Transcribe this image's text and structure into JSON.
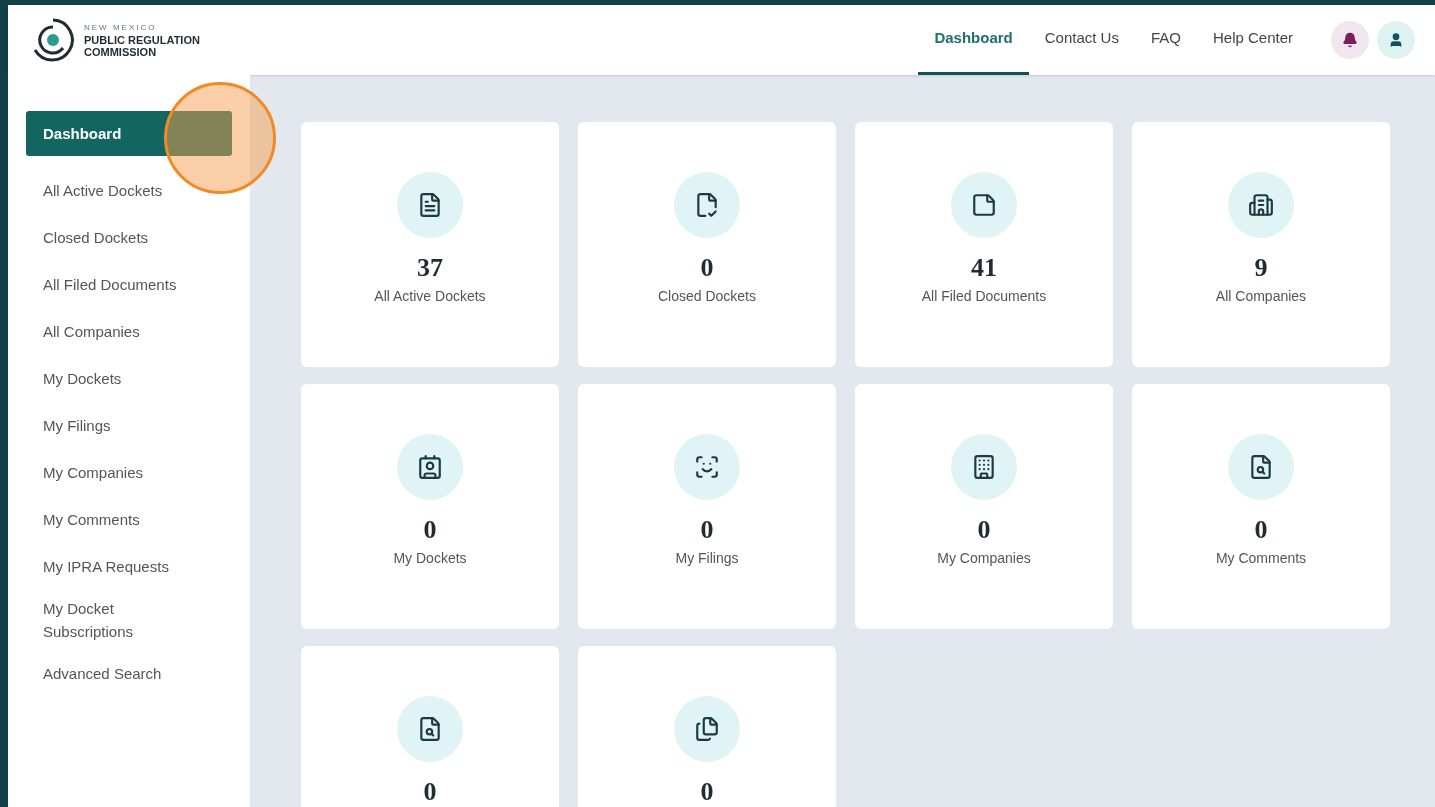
{
  "logo": {
    "line_1": "NEW MEXICO",
    "line_2": "PUBLIC REGULATION",
    "line_3": "COMMISSION"
  },
  "nav": [
    {
      "label": "Dashboard",
      "selected": true
    },
    {
      "label": "Contact Us",
      "selected": false
    },
    {
      "label": "FAQ",
      "selected": false
    },
    {
      "label": "Help Center",
      "selected": false
    }
  ],
  "sidebar": {
    "items": [
      {
        "label": "Dashboard",
        "selected": true
      },
      {
        "label": "All Active Dockets",
        "selected": false
      },
      {
        "label": "Closed Dockets",
        "selected": false
      },
      {
        "label": "All Filed Documents",
        "selected": false
      },
      {
        "label": "All Companies",
        "selected": false
      },
      {
        "label": "My Dockets",
        "selected": false
      },
      {
        "label": "My Filings",
        "selected": false
      },
      {
        "label": "My Companies",
        "selected": false
      },
      {
        "label": "My Comments",
        "selected": false
      },
      {
        "label": "My IPRA Requests",
        "selected": false
      },
      {
        "label": "My Docket Subscriptions",
        "selected": false
      },
      {
        "label": "Advanced Search",
        "selected": false
      }
    ]
  },
  "cards": [
    {
      "kind": "dockets",
      "count": "37",
      "label": "All Active Dockets"
    },
    {
      "kind": "closed",
      "count": "0",
      "label": "Closed Dockets"
    },
    {
      "kind": "documents",
      "count": "41",
      "label": "All Filed Documents"
    },
    {
      "kind": "companies",
      "count": "9",
      "label": "All Companies"
    },
    {
      "kind": "my-dockets",
      "count": "0",
      "label": "My Dockets"
    },
    {
      "kind": "filings",
      "count": "0",
      "label": "My Filings"
    },
    {
      "kind": "my-companies",
      "count": "0",
      "label": "My Companies"
    },
    {
      "kind": "comments",
      "count": "0",
      "label": "My Comments"
    },
    {
      "kind": "comments",
      "count": "0"
    },
    {
      "kind": "subscriptions",
      "count": "0"
    }
  ]
}
